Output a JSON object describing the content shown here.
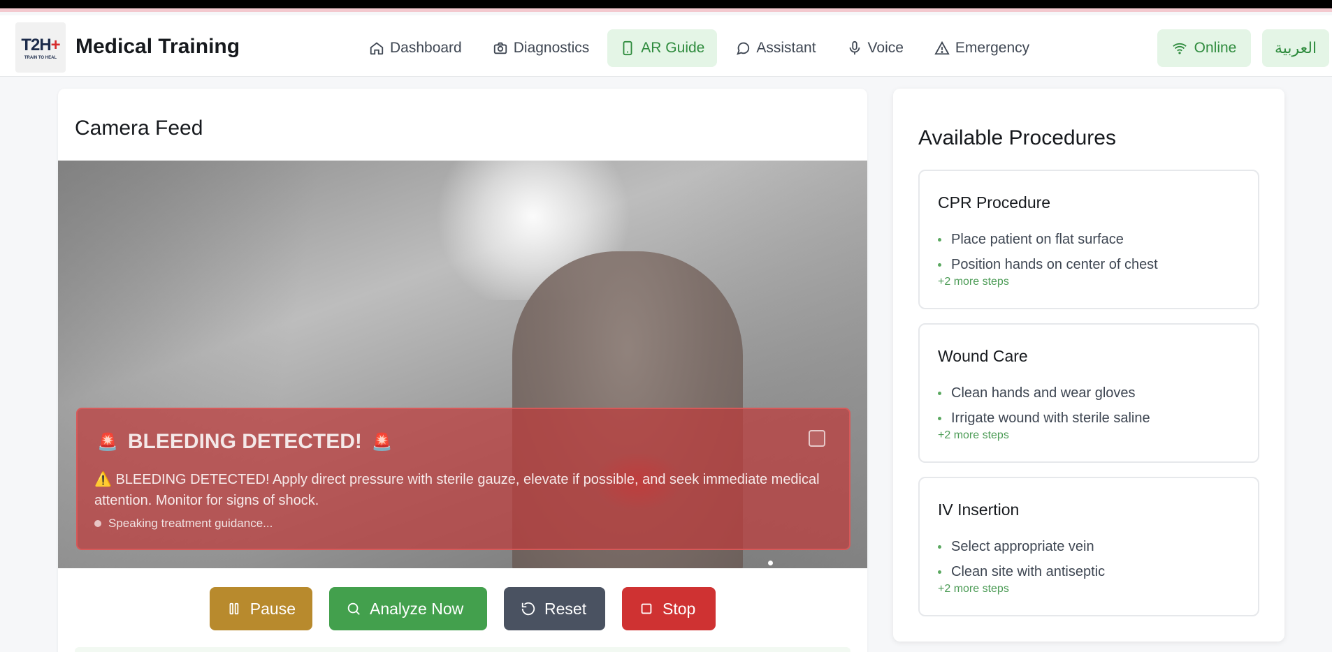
{
  "header": {
    "logo_text": "T2H",
    "logo_sub": "TRAIN TO HEAL",
    "title": "Medical Training",
    "nav": [
      {
        "label": "Dashboard",
        "icon": "home-icon"
      },
      {
        "label": "Diagnostics",
        "icon": "camera-icon"
      },
      {
        "label": "AR Guide",
        "icon": "phone-icon",
        "active": true
      },
      {
        "label": "Assistant",
        "icon": "chat-icon"
      },
      {
        "label": "Voice",
        "icon": "mic-icon"
      },
      {
        "label": "Emergency",
        "icon": "warning-icon"
      }
    ],
    "status": "Online",
    "language": "العربية"
  },
  "camera": {
    "title": "Camera Feed",
    "alert": {
      "title": "BLEEDING DETECTED!",
      "warning_glyph": "⚠️",
      "message": "BLEEDING DETECTED! Apply direct pressure with sterile gauze, elevate if possible, and seek immediate medical attention. Monitor for signs of shock.",
      "status": "Speaking treatment guidance..."
    },
    "controls": {
      "pause": "Pause",
      "analyze": "Analyze Now",
      "reset": "Reset",
      "stop": "Stop"
    }
  },
  "procedures": {
    "title": "Available Procedures",
    "items": [
      {
        "name": "CPR Procedure",
        "steps": [
          "Place patient on flat surface",
          "Position hands on center of chest"
        ],
        "more": "+2 more steps"
      },
      {
        "name": "Wound Care",
        "steps": [
          "Clean hands and wear gloves",
          "Irrigate wound with sterile saline"
        ],
        "more": "+2 more steps"
      },
      {
        "name": "IV Insertion",
        "steps": [
          "Select appropriate vein",
          "Clean site with antiseptic"
        ],
        "more": "+2 more steps"
      }
    ]
  },
  "colors": {
    "accent_green": "#2e8b3d",
    "active_bg": "#e4f5e6",
    "alert_red": "#be3c3c",
    "pause": "#b88a2d",
    "analyze": "#43a04d",
    "reset": "#4a5261",
    "stop": "#cf3232"
  }
}
